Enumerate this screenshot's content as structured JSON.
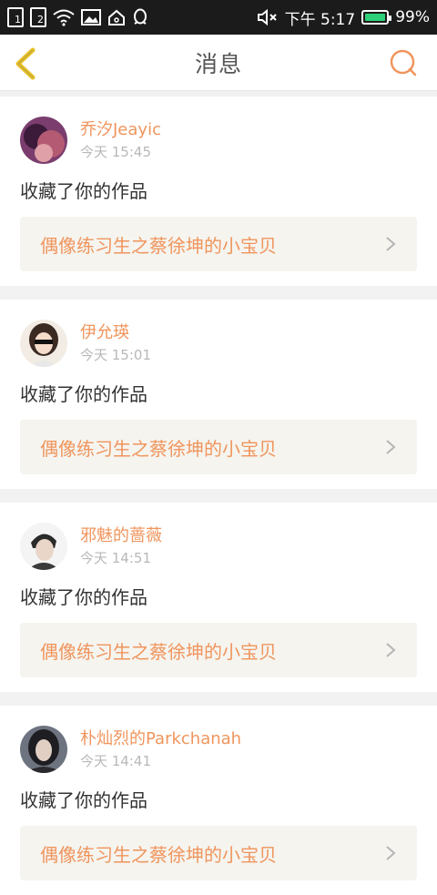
{
  "status_bar": {
    "sim1": "1",
    "sim2": "2",
    "time": "下午 5:17",
    "battery": "99%",
    "battery_level": 0.99
  },
  "header": {
    "title": "消息",
    "back_icon": "back-chevron-icon",
    "search_icon": "search-icon"
  },
  "colors": {
    "accent": "#f0955d",
    "back_icon": "#e8c22a",
    "link_bg": "#f5f4ef"
  },
  "messages": [
    {
      "username": "乔汐Jeayic",
      "time": "今天 15:45",
      "action": "收藏了你的作品",
      "work_title": "偶像练习生之蔡徐坤的小宝贝"
    },
    {
      "username": "伊允瑛",
      "time": "今天 15:01",
      "action": "收藏了你的作品",
      "work_title": "偶像练习生之蔡徐坤的小宝贝"
    },
    {
      "username": "邪魅的蔷薇",
      "time": "今天 14:51",
      "action": "收藏了你的作品",
      "work_title": "偶像练习生之蔡徐坤的小宝贝"
    },
    {
      "username": "朴灿烈的Parkchanah",
      "time": "今天 14:41",
      "action": "收藏了你的作品",
      "work_title": "偶像练习生之蔡徐坤的小宝贝"
    }
  ]
}
